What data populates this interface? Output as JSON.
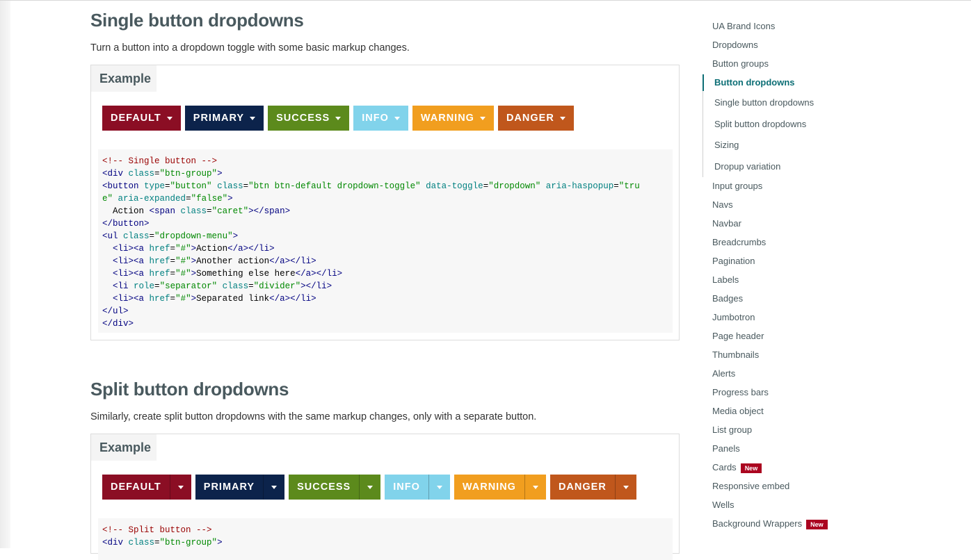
{
  "sections": [
    {
      "title": "Single button dropdowns",
      "description": "Turn a button into a dropdown toggle with some basic markup changes.",
      "example_label": "Example",
      "buttons": [
        {
          "label": "DEFAULT",
          "color": "#8b0e24"
        },
        {
          "label": "PRIMARY",
          "color": "#0c234b"
        },
        {
          "label": "SUCCESS",
          "color": "#5c8a1c"
        },
        {
          "label": "INFO",
          "color": "#81d3eb"
        },
        {
          "label": "WARNING",
          "color": "#f19e1f"
        },
        {
          "label": "DANGER",
          "color": "#c0571c"
        }
      ],
      "code_lines": [
        [
          {
            "c": "com",
            "t": "<!-- Single button -->"
          }
        ],
        [
          {
            "c": "tag",
            "t": "<div "
          },
          {
            "c": "atr",
            "t": "class"
          },
          {
            "c": "txt",
            "t": "="
          },
          {
            "c": "val",
            "t": "\"btn-group\""
          },
          {
            "c": "tag",
            "t": ">"
          }
        ],
        [
          {
            "c": "tag",
            "t": "<button "
          },
          {
            "c": "atr",
            "t": "type"
          },
          {
            "c": "txt",
            "t": "="
          },
          {
            "c": "val",
            "t": "\"button\""
          },
          {
            "c": "txt",
            "t": " "
          },
          {
            "c": "atr",
            "t": "class"
          },
          {
            "c": "txt",
            "t": "="
          },
          {
            "c": "val",
            "t": "\"btn btn-default dropdown-toggle\""
          },
          {
            "c": "txt",
            "t": " "
          },
          {
            "c": "atr",
            "t": "data-toggle"
          },
          {
            "c": "txt",
            "t": "="
          },
          {
            "c": "val",
            "t": "\"dropdown\""
          },
          {
            "c": "txt",
            "t": " "
          },
          {
            "c": "atr",
            "t": "aria-haspopup"
          },
          {
            "c": "txt",
            "t": "="
          },
          {
            "c": "val",
            "t": "\"tru"
          }
        ],
        [
          {
            "c": "val",
            "t": "e\""
          },
          {
            "c": "txt",
            "t": " "
          },
          {
            "c": "atr",
            "t": "aria-expanded"
          },
          {
            "c": "txt",
            "t": "="
          },
          {
            "c": "val",
            "t": "\"false\""
          },
          {
            "c": "tag",
            "t": ">"
          }
        ],
        [
          {
            "c": "txt",
            "t": "  Action "
          },
          {
            "c": "tag",
            "t": "<span "
          },
          {
            "c": "atr",
            "t": "class"
          },
          {
            "c": "txt",
            "t": "="
          },
          {
            "c": "val",
            "t": "\"caret\""
          },
          {
            "c": "tag",
            "t": "></span>"
          }
        ],
        [
          {
            "c": "tag",
            "t": "</button>"
          }
        ],
        [
          {
            "c": "tag",
            "t": "<ul "
          },
          {
            "c": "atr",
            "t": "class"
          },
          {
            "c": "txt",
            "t": "="
          },
          {
            "c": "val",
            "t": "\"dropdown-menu\""
          },
          {
            "c": "tag",
            "t": ">"
          }
        ],
        [
          {
            "c": "txt",
            "t": "  "
          },
          {
            "c": "tag",
            "t": "<li><a "
          },
          {
            "c": "atr",
            "t": "href"
          },
          {
            "c": "txt",
            "t": "="
          },
          {
            "c": "val",
            "t": "\"#\""
          },
          {
            "c": "tag",
            "t": ">"
          },
          {
            "c": "txt",
            "t": "Action"
          },
          {
            "c": "tag",
            "t": "</a></li>"
          }
        ],
        [
          {
            "c": "txt",
            "t": "  "
          },
          {
            "c": "tag",
            "t": "<li><a "
          },
          {
            "c": "atr",
            "t": "href"
          },
          {
            "c": "txt",
            "t": "="
          },
          {
            "c": "val",
            "t": "\"#\""
          },
          {
            "c": "tag",
            "t": ">"
          },
          {
            "c": "txt",
            "t": "Another action"
          },
          {
            "c": "tag",
            "t": "</a></li>"
          }
        ],
        [
          {
            "c": "txt",
            "t": "  "
          },
          {
            "c": "tag",
            "t": "<li><a "
          },
          {
            "c": "atr",
            "t": "href"
          },
          {
            "c": "txt",
            "t": "="
          },
          {
            "c": "val",
            "t": "\"#\""
          },
          {
            "c": "tag",
            "t": ">"
          },
          {
            "c": "txt",
            "t": "Something else here"
          },
          {
            "c": "tag",
            "t": "</a></li>"
          }
        ],
        [
          {
            "c": "txt",
            "t": "  "
          },
          {
            "c": "tag",
            "t": "<li "
          },
          {
            "c": "atr",
            "t": "role"
          },
          {
            "c": "txt",
            "t": "="
          },
          {
            "c": "val",
            "t": "\"separator\""
          },
          {
            "c": "txt",
            "t": " "
          },
          {
            "c": "atr",
            "t": "class"
          },
          {
            "c": "txt",
            "t": "="
          },
          {
            "c": "val",
            "t": "\"divider\""
          },
          {
            "c": "tag",
            "t": "></li>"
          }
        ],
        [
          {
            "c": "txt",
            "t": "  "
          },
          {
            "c": "tag",
            "t": "<li><a "
          },
          {
            "c": "atr",
            "t": "href"
          },
          {
            "c": "txt",
            "t": "="
          },
          {
            "c": "val",
            "t": "\"#\""
          },
          {
            "c": "tag",
            "t": ">"
          },
          {
            "c": "txt",
            "t": "Separated link"
          },
          {
            "c": "tag",
            "t": "</a></li>"
          }
        ],
        [
          {
            "c": "tag",
            "t": "</ul>"
          }
        ],
        [
          {
            "c": "tag",
            "t": "</div>"
          }
        ]
      ]
    },
    {
      "title": "Split button dropdowns",
      "description": "Similarly, create split button dropdowns with the same markup changes, only with a separate button.",
      "example_label": "Example",
      "buttons": [
        {
          "label": "DEFAULT",
          "color": "#8b0e24"
        },
        {
          "label": "PRIMARY",
          "color": "#0c234b"
        },
        {
          "label": "SUCCESS",
          "color": "#5c8a1c"
        },
        {
          "label": "INFO",
          "color": "#81d3eb"
        },
        {
          "label": "WARNING",
          "color": "#f19e1f"
        },
        {
          "label": "DANGER",
          "color": "#c0571c"
        }
      ],
      "code_lines": [
        [
          {
            "c": "com",
            "t": "<!-- Split button -->"
          }
        ],
        [
          {
            "c": "tag",
            "t": "<div "
          },
          {
            "c": "atr",
            "t": "class"
          },
          {
            "c": "txt",
            "t": "="
          },
          {
            "c": "val",
            "t": "\"btn-group\""
          },
          {
            "c": "tag",
            "t": ">"
          }
        ]
      ]
    }
  ],
  "sidebar": {
    "items": [
      {
        "label": "UA Brand Icons"
      },
      {
        "label": "Dropdowns"
      },
      {
        "label": "Button groups"
      },
      {
        "label": "Button dropdowns",
        "active": true
      },
      {
        "label": "Single button dropdowns",
        "sub": true
      },
      {
        "label": "Split button dropdowns",
        "sub": true
      },
      {
        "label": "Sizing",
        "sub": true
      },
      {
        "label": "Dropup variation",
        "sub": true
      },
      {
        "label": "Input groups"
      },
      {
        "label": "Navs"
      },
      {
        "label": "Navbar"
      },
      {
        "label": "Breadcrumbs"
      },
      {
        "label": "Pagination"
      },
      {
        "label": "Labels"
      },
      {
        "label": "Badges"
      },
      {
        "label": "Jumbotron"
      },
      {
        "label": "Page header"
      },
      {
        "label": "Thumbnails"
      },
      {
        "label": "Alerts"
      },
      {
        "label": "Progress bars"
      },
      {
        "label": "Media object"
      },
      {
        "label": "List group"
      },
      {
        "label": "Panels"
      },
      {
        "label": "Cards",
        "badge": "New"
      },
      {
        "label": "Responsive embed"
      },
      {
        "label": "Wells"
      },
      {
        "label": "Background Wrappers",
        "badge": "New"
      }
    ]
  }
}
